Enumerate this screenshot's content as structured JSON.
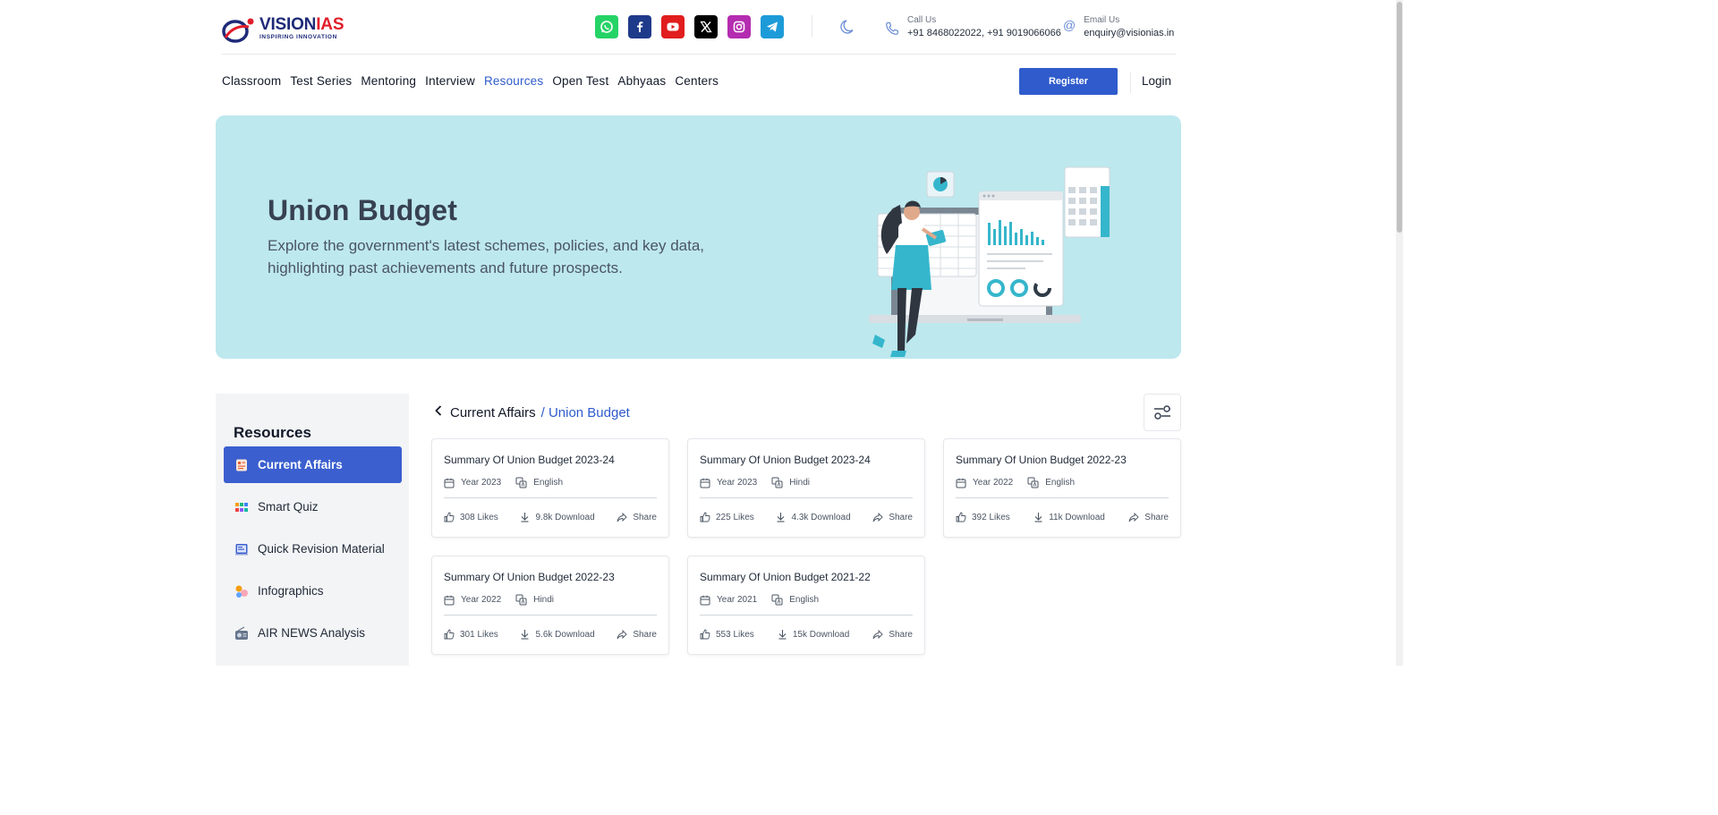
{
  "brand": {
    "name_part1": "VISION",
    "name_part2": "IAS",
    "tagline": "INSPIRING INNOVATION"
  },
  "socials": [
    {
      "name": "whatsapp-icon",
      "color": "#25D366"
    },
    {
      "name": "facebook-icon",
      "color": "#1e3a8a"
    },
    {
      "name": "youtube-icon",
      "color": "#e11d1d"
    },
    {
      "name": "x-icon",
      "color": "#000000"
    },
    {
      "name": "instagram-icon",
      "color": "#b42cb0"
    },
    {
      "name": "telegram-icon",
      "color": "#1d9bd8"
    }
  ],
  "contact": {
    "call_label": "Call Us",
    "call_value": "+91 8468022022, +91 9019066066",
    "email_label": "Email Us",
    "email_value": "enquiry@visionias.in"
  },
  "nav": {
    "items": [
      "Classroom",
      "Test Series",
      "Mentoring",
      "Interview",
      "Resources",
      "Open Test",
      "Abhyaas",
      "Centers"
    ],
    "active": "Resources",
    "register": "Register",
    "login": "Login"
  },
  "banner": {
    "title": "Union Budget",
    "description": "Explore the government's latest schemes, policies, and key data, highlighting past achievements and future prospects."
  },
  "sidebar": {
    "title": "Resources",
    "items": [
      {
        "label": "Current Affairs",
        "active": true
      },
      {
        "label": "Smart Quiz",
        "active": false
      },
      {
        "label": "Quick Revision Material",
        "active": false
      },
      {
        "label": "Infographics",
        "active": false
      },
      {
        "label": "AIR NEWS Analysis",
        "active": false
      }
    ]
  },
  "breadcrumb": {
    "parent": "Current Affairs",
    "current": "/ Union Budget"
  },
  "cards": [
    {
      "title": "Summary Of Union Budget 2023-24",
      "year": "Year 2023",
      "language": "English",
      "likes": "308 Likes",
      "downloads": "9.8k Download",
      "share": "Share"
    },
    {
      "title": "Summary Of Union Budget 2023-24",
      "year": "Year 2023",
      "language": "Hindi",
      "likes": "225 Likes",
      "downloads": "4.3k Download",
      "share": "Share"
    },
    {
      "title": "Summary Of Union Budget 2022-23",
      "year": "Year 2022",
      "language": "English",
      "likes": "392 Likes",
      "downloads": "11k Download",
      "share": "Share"
    },
    {
      "title": "Summary Of Union Budget 2022-23",
      "year": "Year 2022",
      "language": "Hindi",
      "likes": "301 Likes",
      "downloads": "5.6k Download",
      "share": "Share"
    },
    {
      "title": "Summary Of Union Budget 2021-22",
      "year": "Year 2021",
      "language": "English",
      "likes": "553 Likes",
      "downloads": "15k Download",
      "share": "Share"
    }
  ],
  "colors": {
    "accent": "#2f5bcc",
    "banner_bg": "#bde8ee",
    "sidebar_bg": "#f3f4f6"
  }
}
